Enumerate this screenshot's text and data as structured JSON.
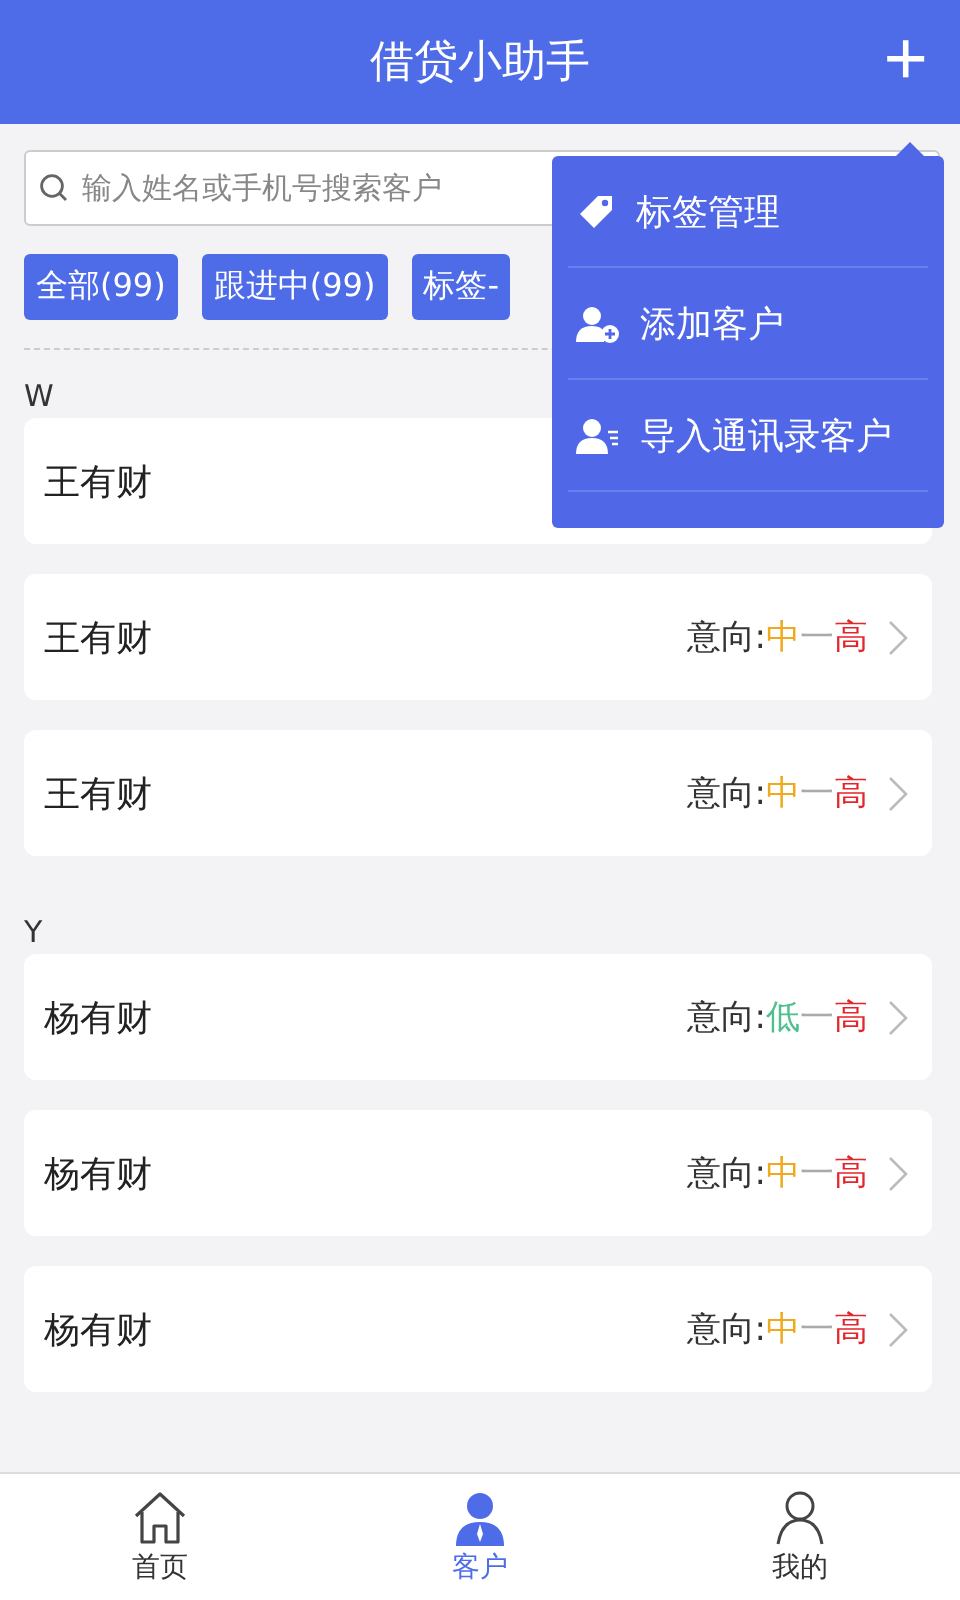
{
  "header": {
    "title": "借贷小助手",
    "action": "+"
  },
  "search": {
    "placeholder": "输入姓名或手机号搜索客户"
  },
  "filters": [
    {
      "label": "全部(99)"
    },
    {
      "label": "跟进中(99)"
    },
    {
      "label": "标签-"
    }
  ],
  "menu": [
    {
      "label": "标签管理",
      "kind": "tag"
    },
    {
      "label": "添加客户",
      "kind": "add-user"
    },
    {
      "label": "导入通讯录客户",
      "kind": "import"
    }
  ],
  "groups": [
    {
      "letter": "W",
      "customers": [
        {
          "name": "王有财"
        },
        {
          "name": "王有财",
          "intent": {
            "label": "意向:",
            "from": {
              "text": "中",
              "color": "#f0a81c"
            },
            "sep": "一",
            "to": {
              "text": "高",
              "color": "#e3262b"
            }
          }
        },
        {
          "name": "王有财",
          "intent": {
            "label": "意向:",
            "from": {
              "text": "中",
              "color": "#f0a81c"
            },
            "sep": "一",
            "to": {
              "text": "高",
              "color": "#e3262b"
            }
          }
        }
      ]
    },
    {
      "letter": "Y",
      "customers": [
        {
          "name": "杨有财",
          "intent": {
            "label": "意向:",
            "from": {
              "text": "低",
              "color": "#4fc08d"
            },
            "sep": "一",
            "to": {
              "text": "高",
              "color": "#e3262b"
            }
          }
        },
        {
          "name": "杨有财",
          "intent": {
            "label": "意向:",
            "from": {
              "text": "中",
              "color": "#f0a81c"
            },
            "sep": "一",
            "to": {
              "text": "高",
              "color": "#e3262b"
            }
          }
        },
        {
          "name": "杨有财",
          "intent": {
            "label": "意向:",
            "from": {
              "text": "中",
              "color": "#f0a81c"
            },
            "sep": "一",
            "to": {
              "text": "高",
              "color": "#e3262b"
            }
          }
        }
      ]
    }
  ],
  "tabs": [
    {
      "label": "首页",
      "kind": "home",
      "selected": false
    },
    {
      "label": "客户",
      "kind": "customer",
      "selected": true
    },
    {
      "label": "我的",
      "kind": "profile",
      "selected": false
    }
  ]
}
